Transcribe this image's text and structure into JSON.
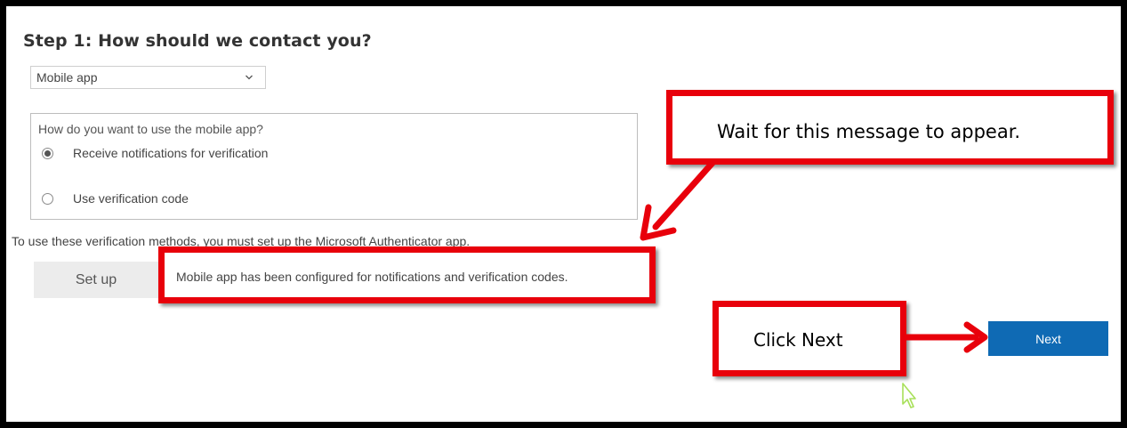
{
  "step_title": "Step 1: How should we contact you?",
  "contact_method": {
    "selected": "Mobile app"
  },
  "mobile_app_group": {
    "legend": "How do you want to use the mobile app?",
    "options": [
      {
        "label": "Receive notifications for verification",
        "checked": true
      },
      {
        "label": "Use verification code",
        "checked": false
      }
    ]
  },
  "info_text": "To use these verification methods, you must set up the Microsoft Authenticator app.",
  "setup_button": "Set up",
  "config_message": "Mobile app has been configured for notifications and verification codes.",
  "callouts": {
    "wait": "Wait for this message to appear.",
    "click_next": "Click Next"
  },
  "next_button": "Next",
  "colors": {
    "annotation_red": "#e8000b",
    "primary_button": "#0f6ab4",
    "cursor": "#a8e05a"
  },
  "icons": [
    "chevron-down-icon",
    "radio-checked",
    "radio-unchecked",
    "mouse-cursor-icon"
  ]
}
